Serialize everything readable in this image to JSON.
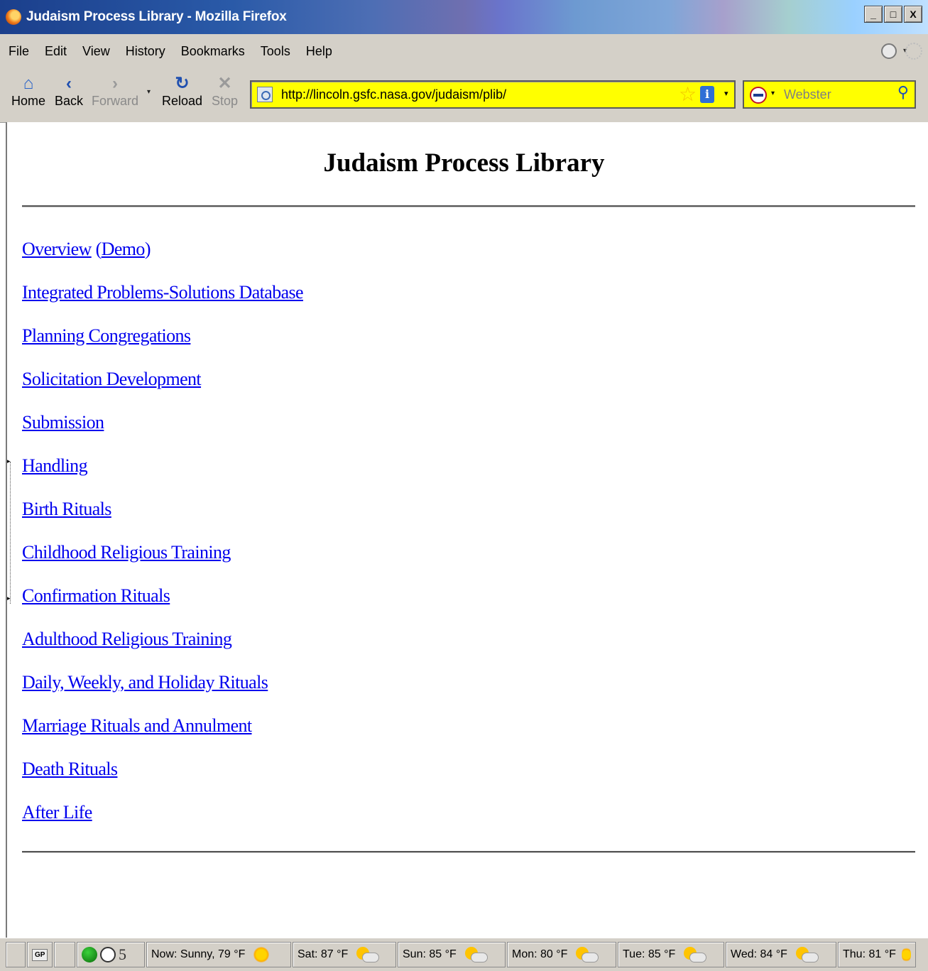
{
  "window": {
    "title": "Judaism Process Library - Mozilla Firefox",
    "buttons": {
      "minimize": "_",
      "maximize": "□",
      "close": "X"
    }
  },
  "menu": [
    "File",
    "Edit",
    "View",
    "History",
    "Bookmarks",
    "Tools",
    "Help"
  ],
  "toolbar": {
    "home": "Home",
    "back": "Back",
    "forward": "Forward",
    "reload": "Reload",
    "stop": "Stop"
  },
  "address": {
    "url": "http://lincoln.gsfc.nasa.gov/judaism/plib/"
  },
  "search": {
    "placeholder": "Webster"
  },
  "page": {
    "title": "Judaism Process Library",
    "overview": {
      "link": "Overview",
      "open_paren": "(",
      "demo": "Demo",
      "close_paren": ")"
    },
    "links": [
      "Integrated Problems-Solutions Database",
      "Planning Congregations",
      "Solicitation Development",
      "Submission",
      "Handling",
      "Birth Rituals",
      "Childhood Religious Training",
      "Confirmation Rituals",
      "Adulthood Religious Training",
      "Daily, Weekly, and Holiday Rituals",
      "Marriage Rituals and Annulment",
      "Death Rituals",
      "After Life"
    ]
  },
  "statusbar": {
    "gp_label": "GP",
    "count": "5",
    "weather": [
      {
        "text": "Now: Sunny, 79 °F",
        "icon": "sun-icon"
      },
      {
        "text": "Sat: 87 °F",
        "icon": "partly-cloudy-icon"
      },
      {
        "text": "Sun: 85 °F",
        "icon": "partly-cloudy-icon"
      },
      {
        "text": "Mon: 80 °F",
        "icon": "partly-cloudy-icon"
      },
      {
        "text": "Tue: 85 °F",
        "icon": "partly-cloudy-icon"
      },
      {
        "text": "Wed: 84 °F",
        "icon": "partly-cloudy-icon"
      },
      {
        "text": "Thu: 81 °F",
        "icon": "partly-cloudy-icon"
      }
    ]
  },
  "colors": {
    "link": "#0000ee",
    "address_bg": "#ffff00",
    "chrome": "#d4d0c8"
  }
}
